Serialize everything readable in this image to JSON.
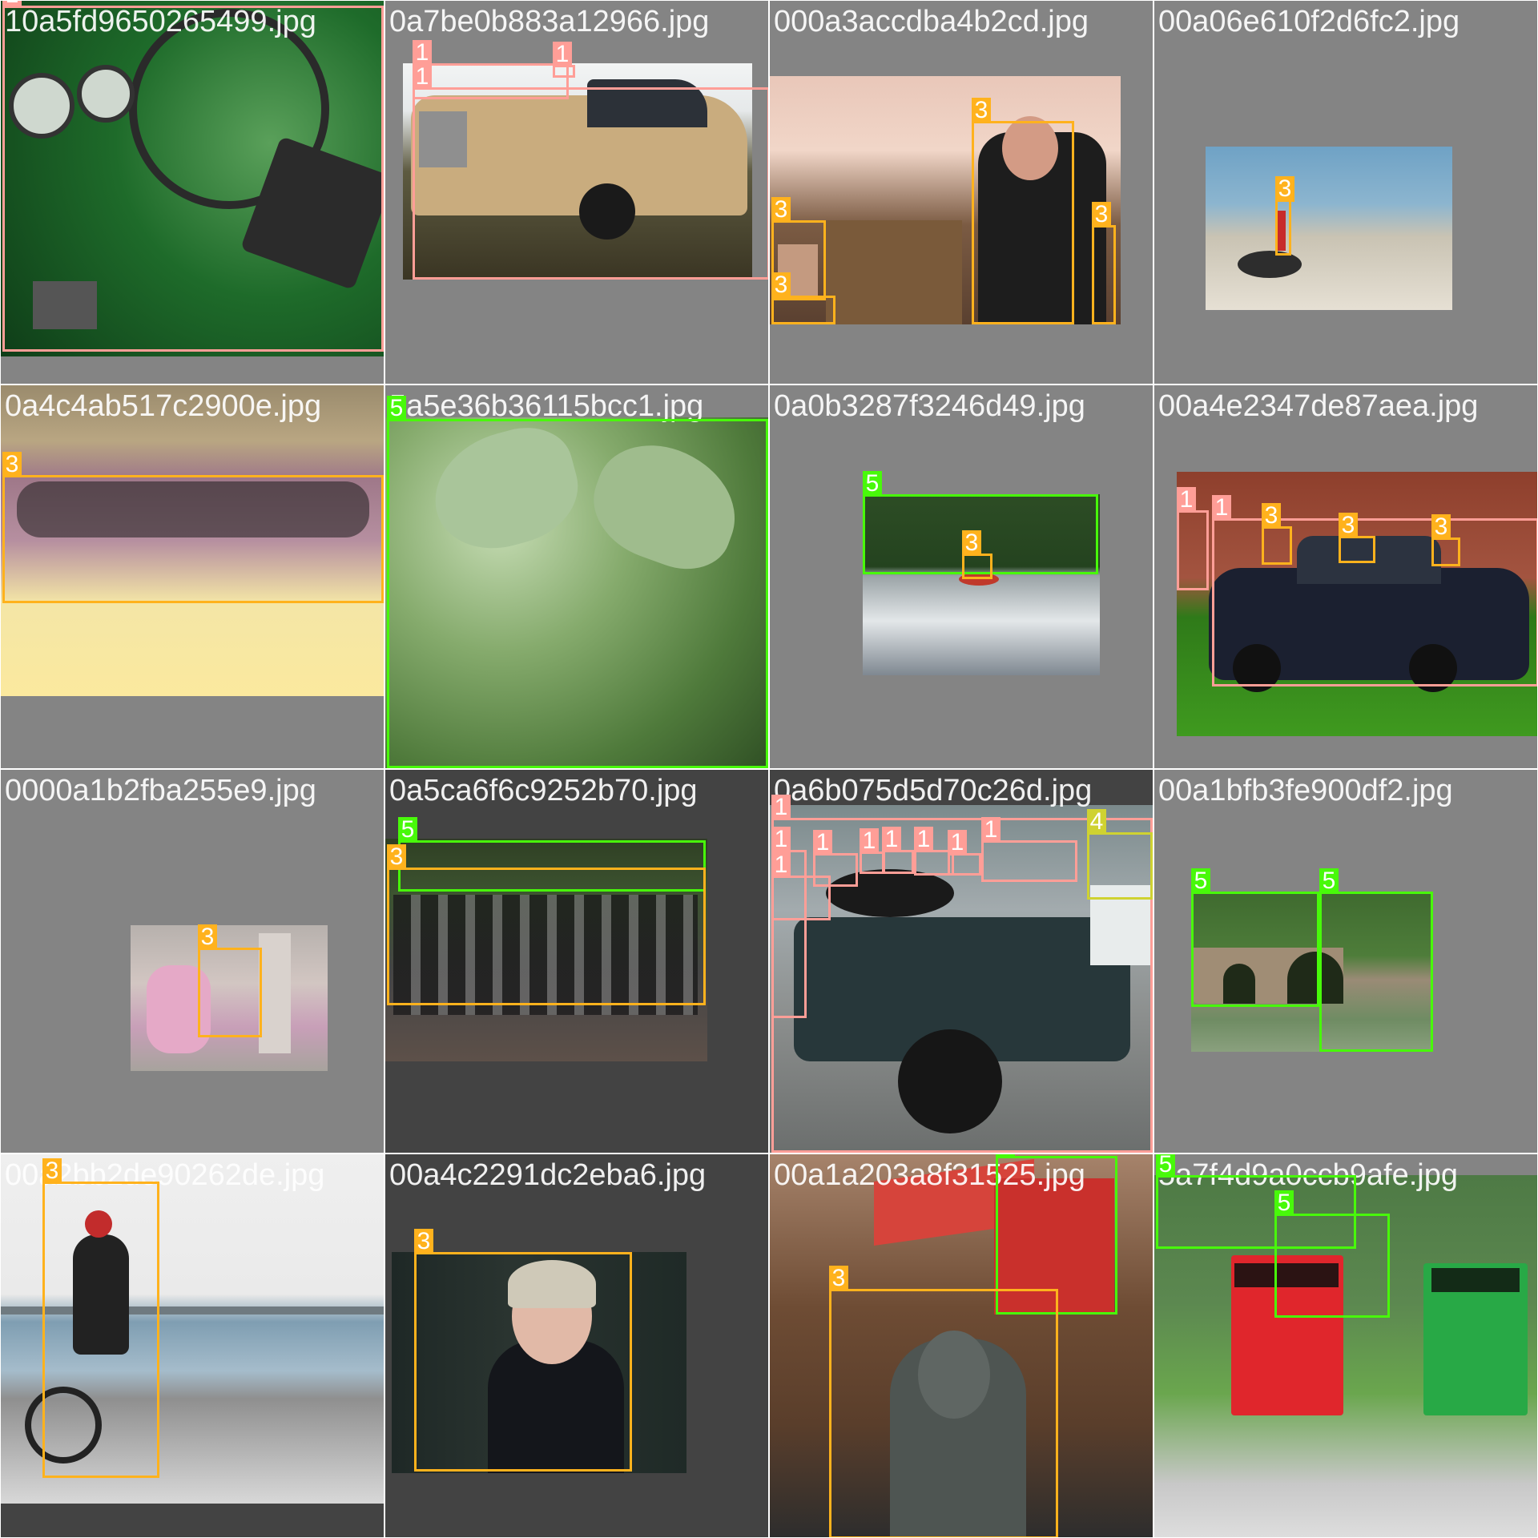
{
  "colors": {
    "class_1": "#ff9e97",
    "class_3": "#ffb21d",
    "class_4": "#cfd231",
    "class_5": "#48f90a",
    "tile_bg_gray": "#848484",
    "tile_bg_dark": "#434343"
  },
  "tiles": [
    {
      "filename": "10a5fd9650265499.jpg",
      "labels": [
        "1"
      ]
    },
    {
      "filename": "0a7be0b883a12966.jpg",
      "labels": [
        "1",
        "1",
        "1"
      ]
    },
    {
      "filename": "000a3accdba4b2cd.jpg",
      "labels": [
        "3",
        "3",
        "3",
        "3"
      ]
    },
    {
      "filename": "00a06e610f2d6fc2.jpg",
      "labels": [
        "3"
      ]
    },
    {
      "filename": "0a4c4ab517c2900e.jpg",
      "labels": [
        "3"
      ]
    },
    {
      "filename": "5a5e36b36115bcc1.jpg",
      "labels": [
        "5"
      ]
    },
    {
      "filename": "0a0b3287f3246d49.jpg",
      "labels": [
        "5",
        "3"
      ]
    },
    {
      "filename": "00a4e2347de87aea.jpg",
      "labels": [
        "1",
        "1",
        "3",
        "3",
        "3"
      ]
    },
    {
      "filename": "0000a1b2fba255e9.jpg",
      "labels": [
        "3"
      ]
    },
    {
      "filename": "0a5ca6f6c9252b70.jpg",
      "labels": [
        "5",
        "3"
      ]
    },
    {
      "filename": "0a6b075d5d70c26d.jpg",
      "labels": [
        "1",
        "1",
        "1",
        "1",
        "1",
        "1",
        "1",
        "1",
        "1",
        "4"
      ]
    },
    {
      "filename": "00a1bfb3fe900df2.jpg",
      "labels": [
        "5",
        "5"
      ]
    },
    {
      "filename": "00a2bb2de90262de.jpg",
      "labels": [
        "3"
      ]
    },
    {
      "filename": "00a4c2291dc2eba6.jpg",
      "labels": [
        "3"
      ]
    },
    {
      "filename": "00a1a203a8f31525.jpg",
      "labels": [
        "5",
        "3"
      ]
    },
    {
      "filename": "5a7f4d9a0ccb9afe.jpg",
      "labels": [
        "5",
        "5"
      ]
    }
  ]
}
